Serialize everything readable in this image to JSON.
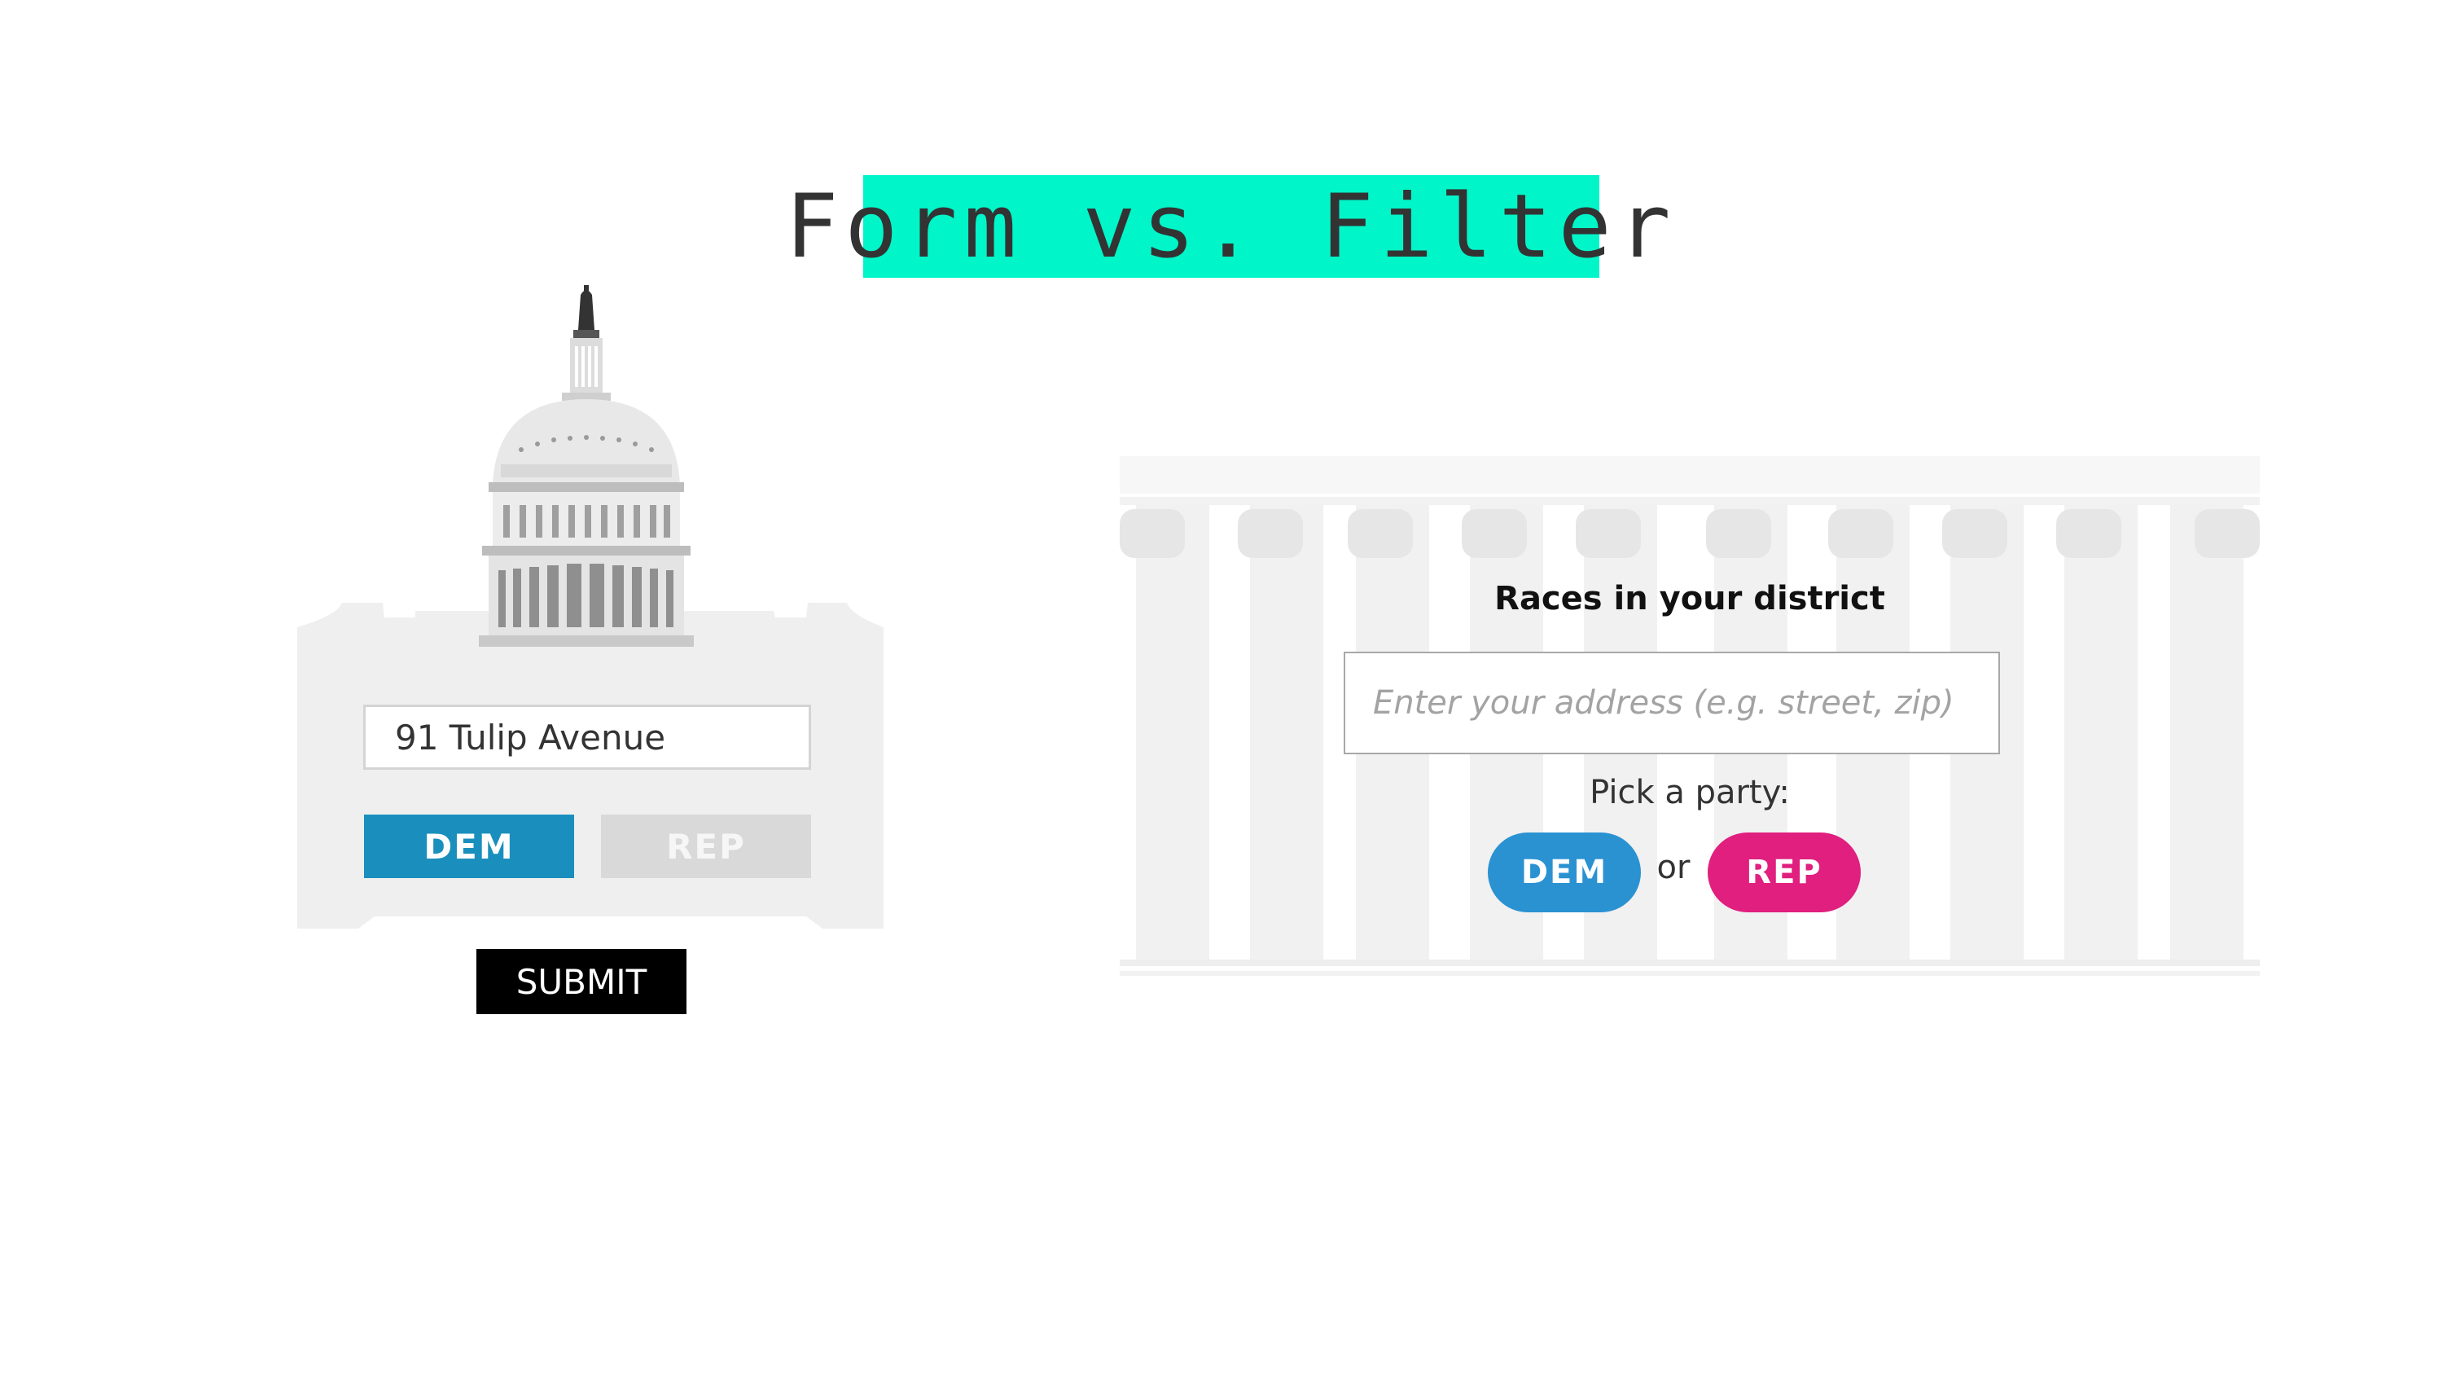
{
  "title": "Form vs. Filter",
  "colors": {
    "title_highlight": "#00f5c8",
    "form_dem": "#1a8fbd",
    "form_rep_inactive": "#d9d9d9",
    "filter_dem": "#2b92d2",
    "filter_rep": "#e01f7f"
  },
  "form": {
    "illustration": "capitol-building-icon",
    "address_value": "91 Tulip Avenue",
    "dem_label": "DEM",
    "rep_label": "REP",
    "submit_label": "SUBMIT"
  },
  "filter": {
    "illustration": "columns-building-icon",
    "heading": "Races in your district",
    "address_placeholder": "Enter your address (e.g. street, zip)",
    "pick_label": "Pick a party:",
    "dem_label": "DEM",
    "or_label": "or",
    "rep_label": "REP"
  }
}
